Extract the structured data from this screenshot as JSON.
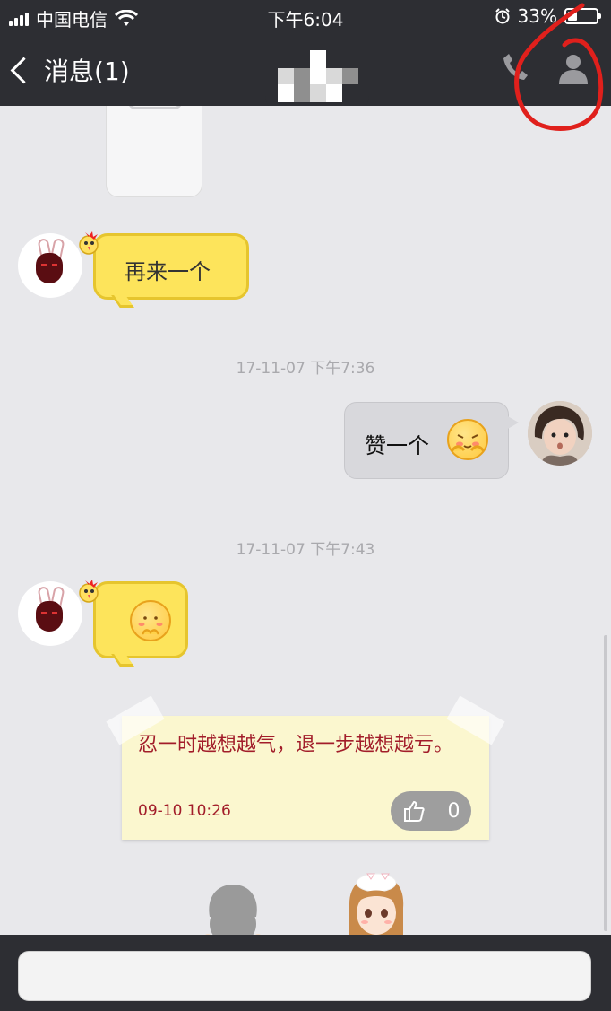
{
  "status_bar": {
    "carrier": "中国电信",
    "time": "下午6:04",
    "battery_percent": "33%",
    "battery_level": 0.33
  },
  "header": {
    "back_label": "消息(1)"
  },
  "messages": [
    {
      "type": "incoming",
      "text": "再来一个"
    },
    {
      "type": "timestamp",
      "text": "17-11-07 下午7:36"
    },
    {
      "type": "outgoing",
      "text": "赞一个"
    },
    {
      "type": "timestamp",
      "text": "17-11-07 下午7:43"
    },
    {
      "type": "incoming-emoji"
    }
  ],
  "note": {
    "text": "忍一时越想越气，退一步越想越亏。",
    "date": "09-10 10:26",
    "like_count": "0"
  },
  "input": {
    "placeholder": ""
  },
  "colors": {
    "header_bg": "#2d2e33",
    "yellow_bubble": "#fde45b",
    "gray_bubble": "#d8d8dc",
    "note_text": "#a21d2a",
    "annotation_red": "#e0201c"
  },
  "icons": [
    "back-chevron-icon",
    "wifi-icon",
    "alarm-icon",
    "battery-icon",
    "phone-icon",
    "profile-icon",
    "thumbs-up-icon"
  ]
}
